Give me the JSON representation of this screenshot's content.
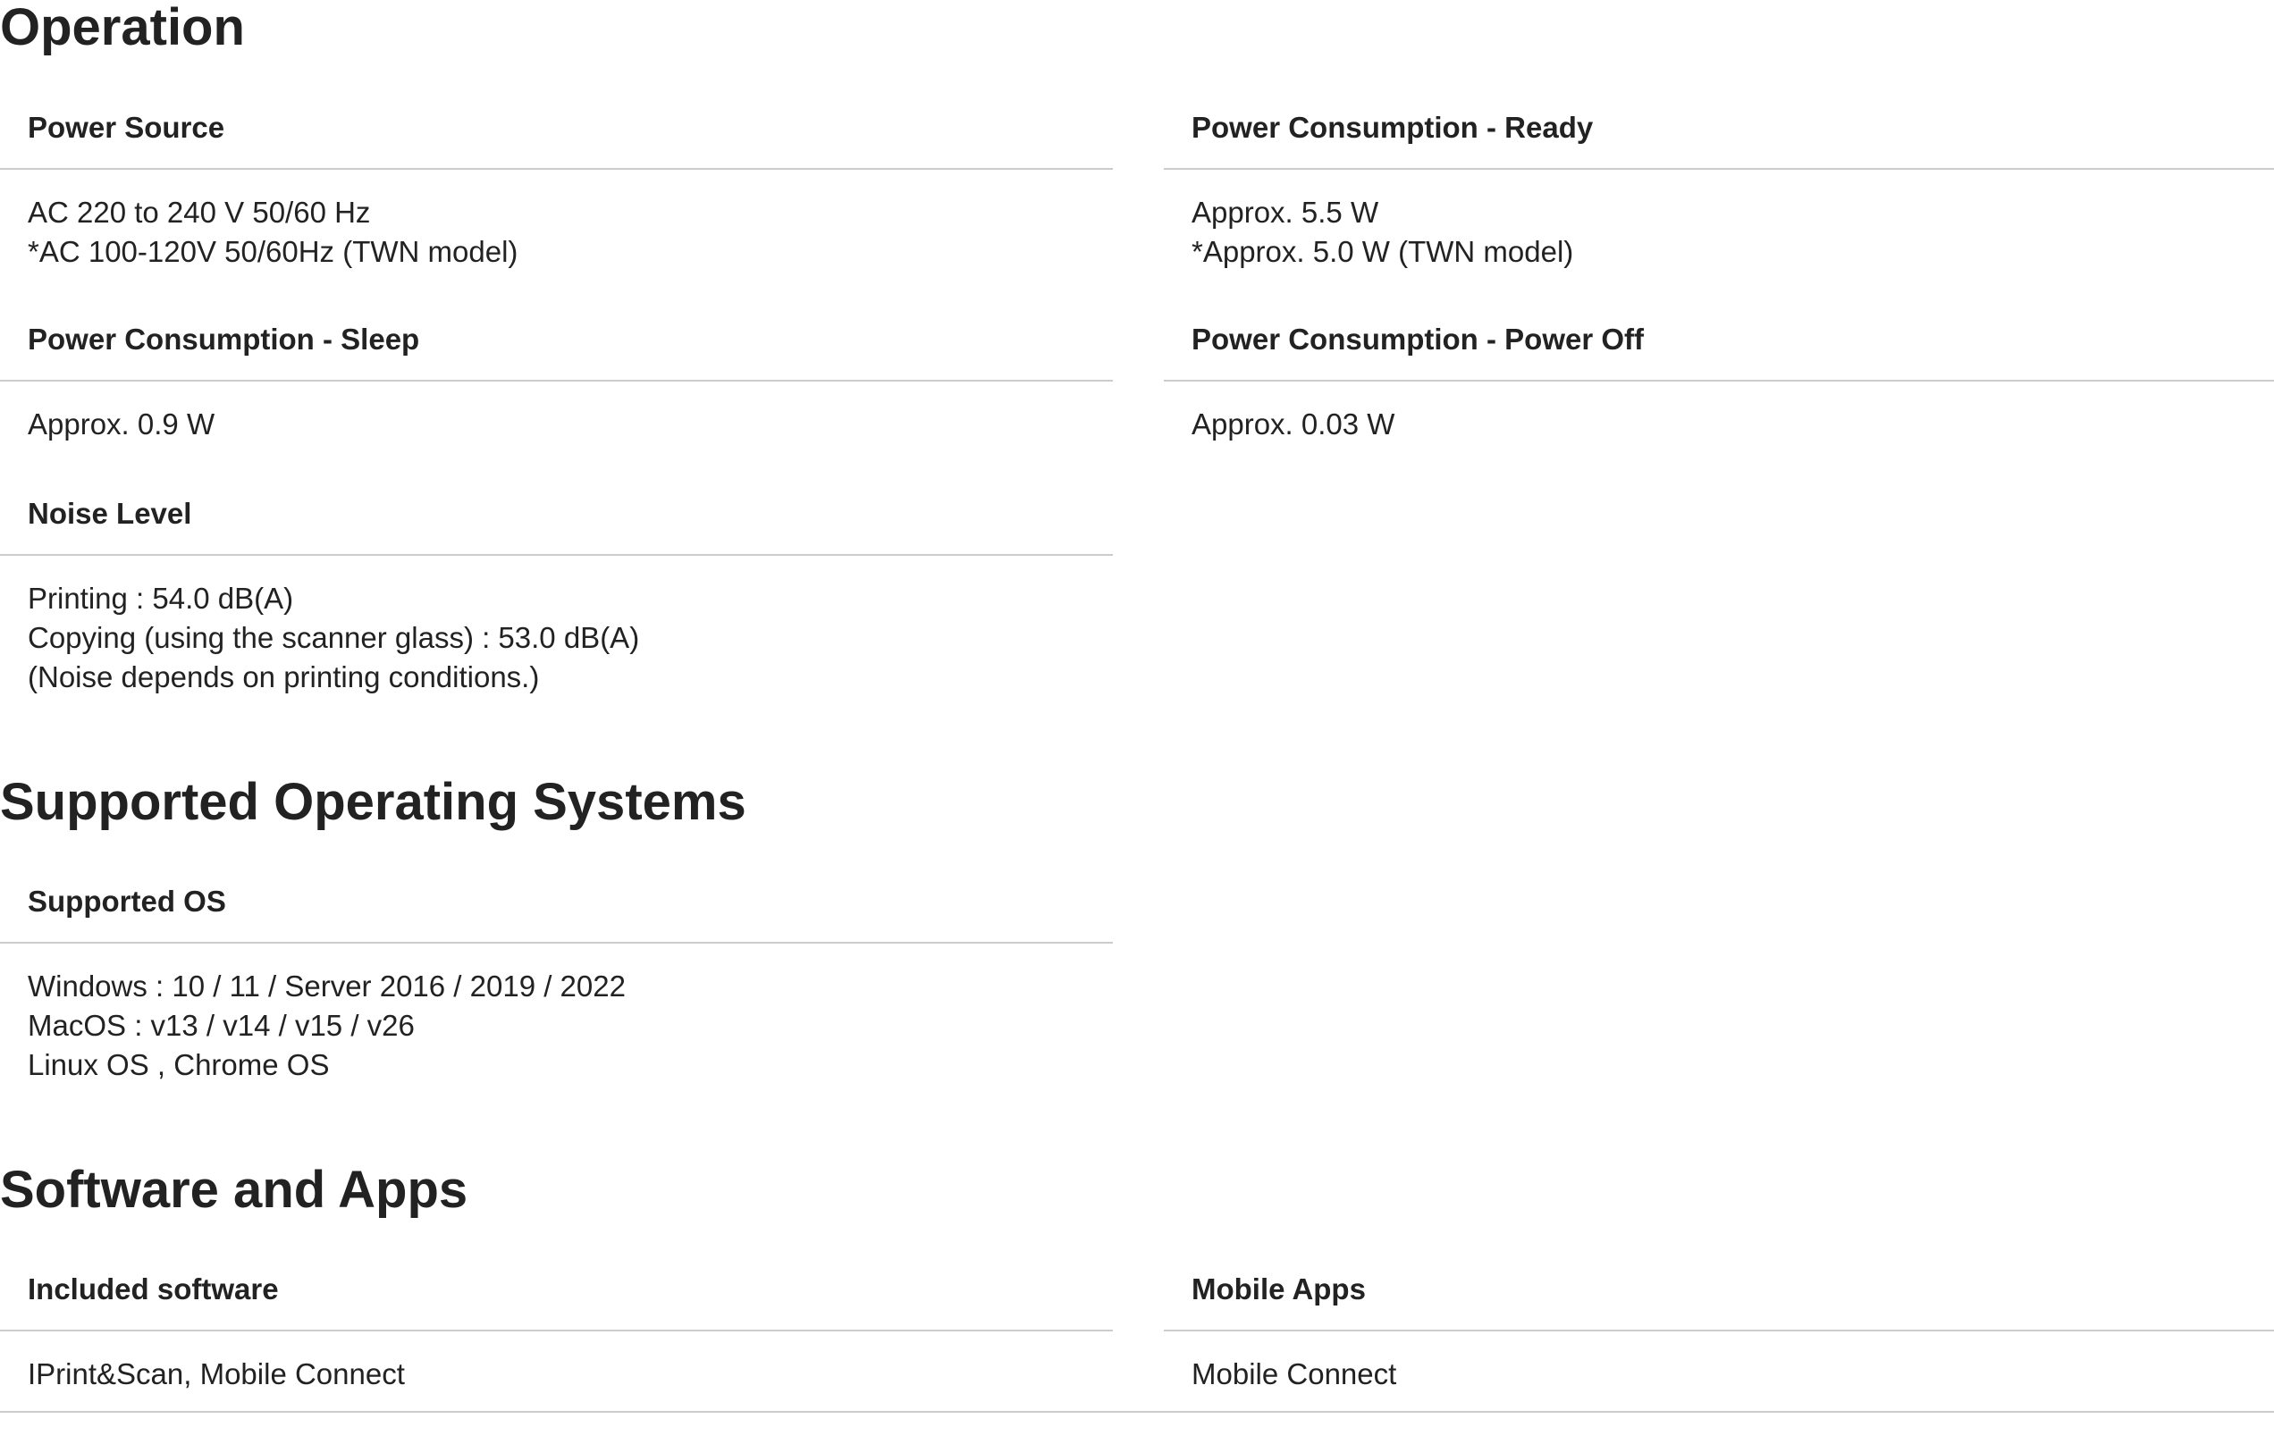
{
  "sections": {
    "operation": {
      "title": "Operation",
      "power_source": {
        "label": "Power Source",
        "lines": [
          "AC 220 to 240 V 50/60 Hz",
          "*AC 100-120V 50/60Hz (TWN model)"
        ]
      },
      "power_ready": {
        "label": "Power Consumption - Ready",
        "lines": [
          "Approx. 5.5 W",
          "*Approx. 5.0 W (TWN model)"
        ]
      },
      "power_sleep": {
        "label": "Power Consumption - Sleep",
        "lines": [
          "Approx. 0.9 W"
        ]
      },
      "power_off": {
        "label": "Power Consumption - Power Off",
        "lines": [
          "Approx. 0.03 W"
        ]
      },
      "noise_level": {
        "label": "Noise Level",
        "lines": [
          "Printing : 54.0 dB(A)",
          "Copying (using the scanner glass) : 53.0 dB(A)",
          "(Noise depends on printing conditions.)"
        ]
      }
    },
    "supported_os": {
      "title": "Supported Operating Systems",
      "os": {
        "label": "Supported OS",
        "lines": [
          "Windows : 10 / 11 / Server 2016 / 2019 / 2022",
          "MacOS : v13 / v14 / v15 / v26",
          "Linux OS , Chrome OS"
        ]
      }
    },
    "software": {
      "title": "Software and Apps",
      "included": {
        "label": "Included software",
        "lines": [
          "IPrint&Scan, Mobile Connect"
        ]
      },
      "mobile_apps": {
        "label": "Mobile Apps",
        "lines": [
          "Mobile Connect"
        ]
      }
    }
  }
}
